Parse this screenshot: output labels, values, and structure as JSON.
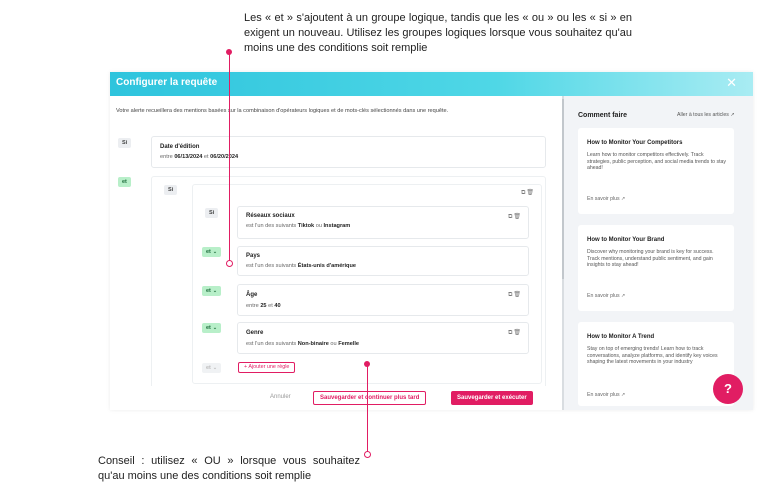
{
  "callouts": {
    "top": "Les « et » s'ajoutent à un groupe logique, tandis que les « ou » ou les « si » en exigent un nouveau. Utilisez les groupes logiques lorsque vous souhaitez qu'au moins une des conditions soit remplie",
    "bottom": "Conseil : utilisez « OU » lorsque vous souhaitez qu'au moins une des conditions soit remplie"
  },
  "modal": {
    "title": "Configurer la requête",
    "close_icon": "close-icon",
    "intro": "Votre alerte recueillera des mentions basées sur la combinaison d'opérateurs logiques et de mots-clés sélectionnés dans une requête.",
    "operators": {
      "si": "Si",
      "et": "et"
    },
    "date_rule": {
      "title": "Date d'édition",
      "prefix": "entre",
      "from": "06/13/2024",
      "joiner": "et",
      "to": "06/20/2024"
    },
    "rules": [
      {
        "title": "Réseaux sociaux",
        "prefix": "est l'un des suivants",
        "v1": "Tiktok",
        "joiner": "ou",
        "v2": "Instagram"
      },
      {
        "title": "Pays",
        "prefix": "est l'un des suivants",
        "v1": "États-unis d'amérique",
        "joiner": "",
        "v2": ""
      },
      {
        "title": "Âge",
        "prefix": "entre",
        "v1": "25",
        "joiner": "et",
        "v2": "40"
      },
      {
        "title": "Genre",
        "prefix": "est l'un des suivants",
        "v1": "Non-binaire",
        "joiner": "ou",
        "v2": "Femelle"
      }
    ],
    "add_rule": "+ Ajouter une règle",
    "footer": {
      "cancel": "Annuler",
      "save_later": "Sauvegarder et continuer plus tard",
      "save_run": "Sauvegarder et exécuter"
    }
  },
  "side": {
    "title": "Comment faire",
    "all_link": "Aller à tous les articles",
    "articles": [
      {
        "title": "How to Monitor Your Competitors",
        "text": "Learn how to monitor competitors effectively. Track strategies, public perception, and social media trends to stay ahead!",
        "more": "En savoir plus"
      },
      {
        "title": "How to Monitor Your Brand",
        "text": "Discover why monitoring your brand is key for success. Track mentions, understand public sentiment, and gain insights to stay ahead!",
        "more": "En savoir plus"
      },
      {
        "title": "How to Monitor A Trend",
        "text": "Stay on top of emerging trends! Learn how to track conversations, analyze platforms, and identify key voices shaping the latest movements in your industry",
        "more": "En savoir plus"
      }
    ]
  },
  "colors": {
    "accent": "#e11d63",
    "header": "#2ec4dd",
    "green_pill": "#b8efc9"
  }
}
